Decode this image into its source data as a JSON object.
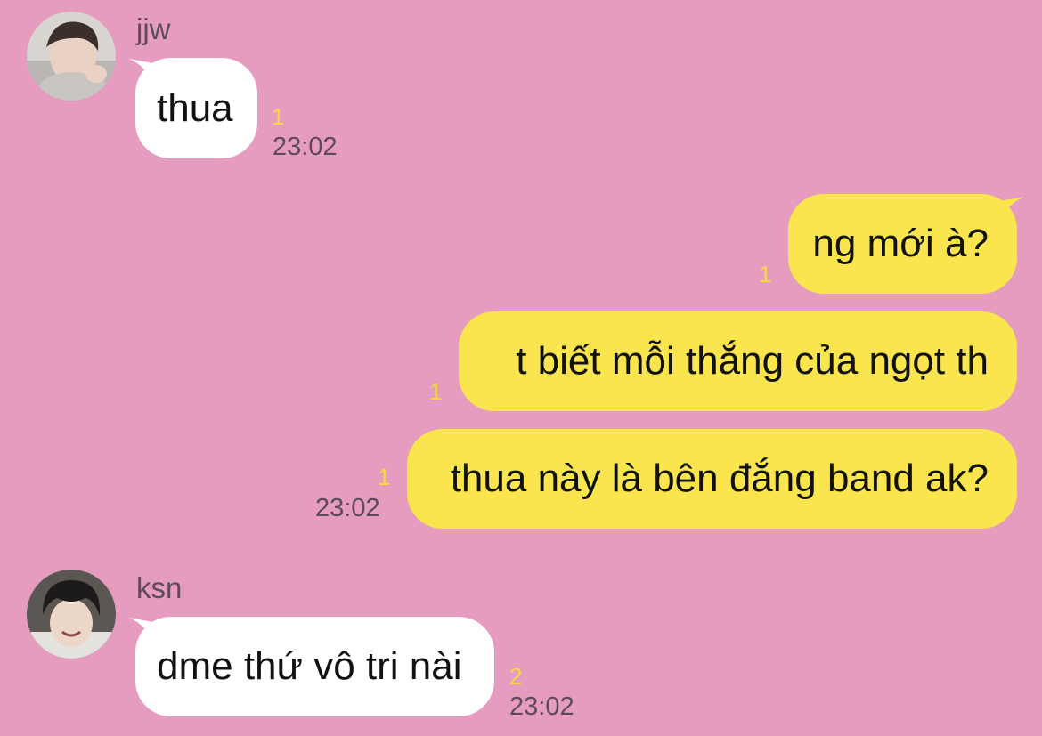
{
  "colors": {
    "background": "#e59cbf",
    "incoming_bubble": "#ffffff",
    "outgoing_bubble": "#fae54e",
    "unread_count": "#f5d940",
    "meta_text": "#5d4a5a"
  },
  "messages": [
    {
      "sender": "jjw",
      "text": "thua",
      "unread": "1",
      "time": "23:02",
      "direction": "incoming"
    },
    {
      "text": "ng mới à?",
      "unread": "1",
      "direction": "outgoing"
    },
    {
      "text": "t biết mỗi thắng của ngọt th",
      "unread": "1",
      "direction": "outgoing"
    },
    {
      "text": "thua này là bên đắng band ak?",
      "unread": "1",
      "time": "23:02",
      "direction": "outgoing"
    },
    {
      "sender": "ksn",
      "text": "dme thứ vô tri nài",
      "unread": "2",
      "time": "23:02",
      "direction": "incoming"
    }
  ]
}
